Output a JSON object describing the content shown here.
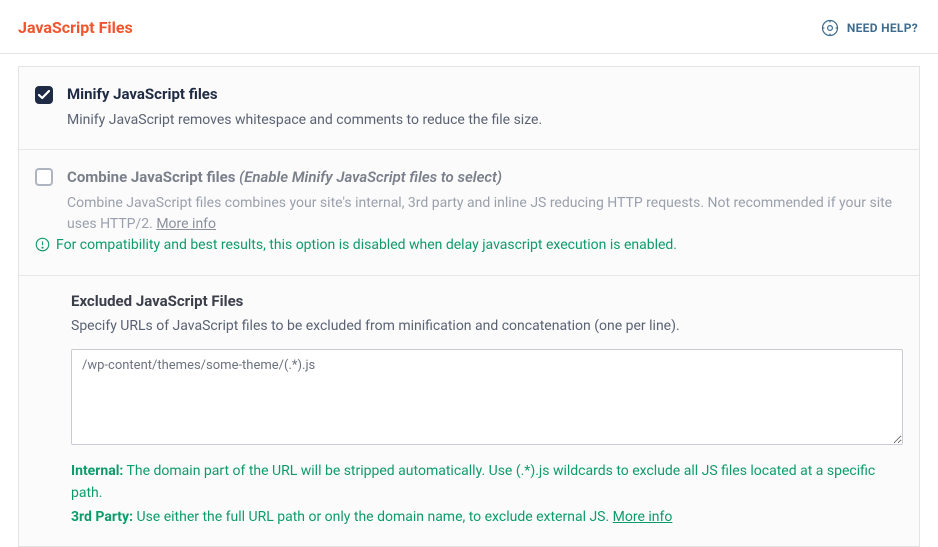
{
  "header": {
    "title": "JavaScript Files",
    "help_label": "NEED HELP?"
  },
  "settings": {
    "minify": {
      "title": "Minify JavaScript files",
      "desc": "Minify JavaScript removes whitespace and comments to reduce the file size.",
      "checked": true
    },
    "combine": {
      "title": "Combine JavaScript files",
      "suffix": "(Enable Minify JavaScript files to select)",
      "desc": "Combine JavaScript files combines your site's internal, 3rd party and inline JS reducing HTTP requests. Not recommended if your site uses HTTP/2.",
      "more_info": "More info",
      "notice": "For compatibility and best results, this option is disabled when delay javascript execution is enabled."
    }
  },
  "excluded": {
    "title": "Excluded JavaScript Files",
    "desc": "Specify URLs of JavaScript files to be excluded from minification and concatenation (one per line).",
    "value": "/wp-content/themes/some-theme/(.*).js",
    "hints": {
      "internal_label": "Internal:",
      "internal_text": " The domain part of the URL will be stripped automatically. Use (.*).js wildcards to exclude all JS files located at a specific path.",
      "third_label": "3rd Party:",
      "third_text": " Use either the full URL path or only the domain name, to exclude external JS. ",
      "more_info": "More info"
    }
  }
}
